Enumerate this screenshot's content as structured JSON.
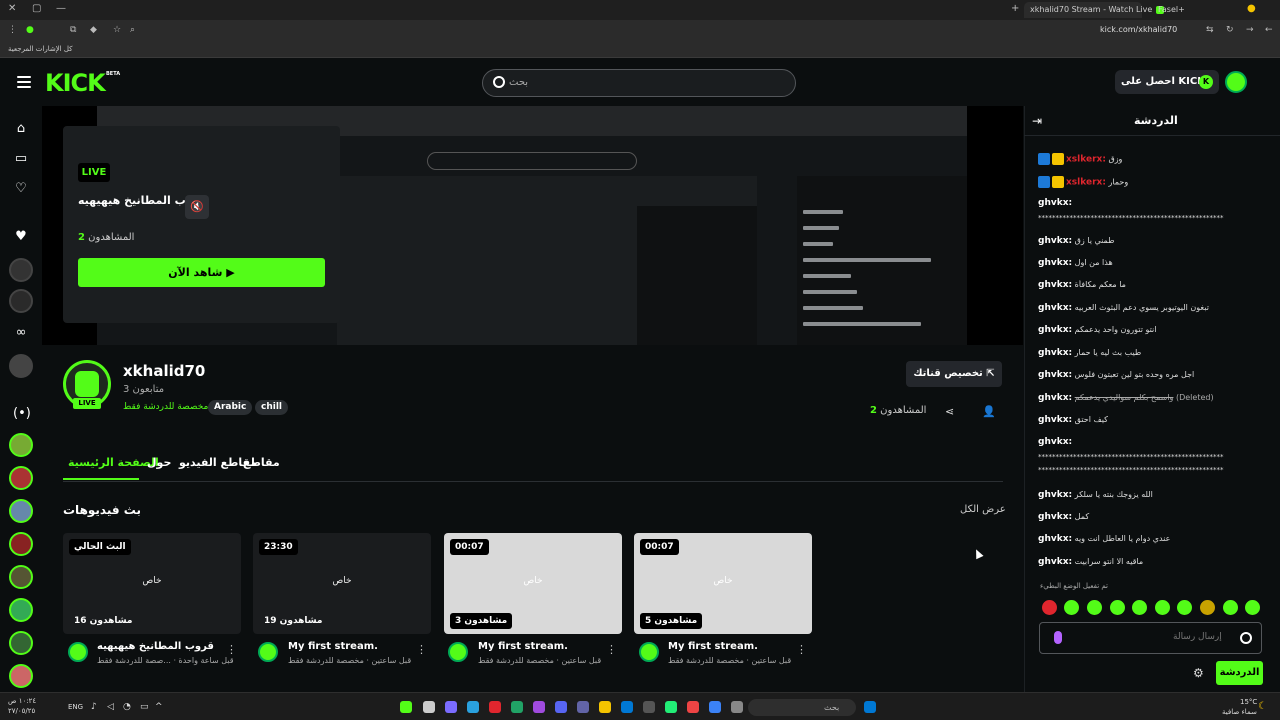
{
  "browser": {
    "tabs": [
      {
        "label": "xkhalid70 Stream - Watch Live",
        "active": true
      },
      {
        "label": "Fasel+",
        "active": false
      }
    ],
    "url": "kick.com/xkhalid70",
    "bookmarks_label": "كل الإشارات المرجعية"
  },
  "header": {
    "logo": "KICK",
    "beta": "BETA",
    "search_placeholder": "بحث",
    "get_kicks": "احصل على KICKs"
  },
  "video": {
    "live_badge": "LIVE",
    "title": "قروب المطانيخ هيهيهيه",
    "viewers_label": "المشاهدون",
    "viewers_count": "2",
    "watch_now": "شاهد الآن"
  },
  "channel": {
    "name": "xkhalid70",
    "followers": "3 متابعون",
    "category": "مخصصة للدردشة فقط",
    "tags": [
      "Arabic",
      "chill"
    ],
    "live": "LIVE",
    "customize": "تخصيص قناتك",
    "viewers_label": "المشاهدون",
    "viewers_count": "2"
  },
  "tabs": [
    "الصفحة الرئيسية",
    "حول",
    "مقاطع الفيديو",
    "مقاطع"
  ],
  "videos_section": {
    "title": "بث فيديوهات",
    "show_all": "عرض الكل",
    "items": [
      {
        "badge": "البث الحالي",
        "center": "خاص",
        "views": "16 مشاهدون",
        "title": "قروب المطانيخ هيهيهيه",
        "sub": "قبل ساعة واحدة · ...صصة للدردشة فقط",
        "thumb": "dark"
      },
      {
        "badge": "23:30",
        "center": "خاص",
        "views": "19 مشاهدون",
        "title": "My first stream.",
        "sub": "قبل ساعتين · مخصصة للدردشة فقط",
        "thumb": "dark"
      },
      {
        "badge": "00:07",
        "center": "خاص",
        "views": "3 مشاهدون",
        "title": "My first stream.",
        "sub": "قبل ساعتين · مخصصة للدردشة فقط",
        "thumb": "light"
      },
      {
        "badge": "00:07",
        "center": "خاص",
        "views": "5 مشاهدون",
        "title": "My first stream.",
        "sub": "قبل ساعتين · مخصصة للدردشة فقط",
        "thumb": "light"
      }
    ]
  },
  "chat": {
    "title": "الدردشة",
    "messages": [
      {
        "user": "xslkerx:",
        "text": "وزق",
        "red": true,
        "badges": true
      },
      {
        "user": "xslkerx:",
        "text": "وحمار",
        "red": true,
        "badges": true
      },
      {
        "user": "ghvkx:",
        "text": "",
        "red": false,
        "badges": false
      },
      {
        "user": "",
        "text": "*****************************************************",
        "red": false,
        "badges": false
      },
      {
        "user": "ghvkx:",
        "text": "طمني يا زق",
        "red": false,
        "badges": false
      },
      {
        "user": "ghvkx:",
        "text": "هذا من اول",
        "red": false,
        "badges": false
      },
      {
        "user": "ghvkx:",
        "text": "ما معكم مكافأة",
        "red": false,
        "badges": false
      },
      {
        "user": "ghvkx:",
        "text": "تبغون اليوتيوبر يسوي دعم البثوث العربيه",
        "red": false,
        "badges": false
      },
      {
        "user": "ghvkx:",
        "text": "انتو تتورون واحد يدعمكم",
        "red": false,
        "badges": false
      },
      {
        "user": "ghvkx:",
        "text": "طيب بث ليه يا حمار",
        "red": false,
        "badges": false
      },
      {
        "user": "ghvkx:",
        "text": "اجل مره وحده بتو لين تعبتون فلوس",
        "red": false,
        "badges": false
      },
      {
        "user": "ghvkx:",
        "text": "واسمح بكلم سواليدي يدعمكم",
        "deleted": "(Deleted)",
        "red": false,
        "badges": false
      },
      {
        "user": "ghvkx:",
        "text": "كيف احتق",
        "red": false,
        "badges": false
      },
      {
        "user": "ghvkx:",
        "text": "",
        "red": false,
        "badges": false
      },
      {
        "user": "",
        "text": "*****************************************************",
        "red": false,
        "badges": false
      },
      {
        "user": "",
        "text": "*****************************************************",
        "red": false,
        "badges": false
      },
      {
        "user": "ghvkx:",
        "text": "الله يزوجك بنته يا سلكر",
        "red": false,
        "badges": false
      },
      {
        "user": "ghvkx:",
        "text": "كمل",
        "red": false,
        "badges": false
      },
      {
        "user": "ghvkx:",
        "text": "عندي دوام يا العاطل انت ويه",
        "red": false,
        "badges": false
      },
      {
        "user": "ghvkx:",
        "text": "ماقيه الا انتو سرابيت",
        "red": false,
        "badges": false
      }
    ],
    "slow_mode": "تم تفعيل الوضع البطيء",
    "input_placeholder": "إرسال رسالة",
    "send_button": "الدردشة"
  },
  "taskbar": {
    "search": "بحث",
    "lang": "ENG",
    "time": "١٠:٢٤ ص",
    "date": "٢٧/٠٥/٢٥",
    "weather_temp": "15°C",
    "weather_desc": "سماء صافية"
  },
  "colors": {
    "accent": "#53fc18",
    "background": "#0b0e0f"
  }
}
